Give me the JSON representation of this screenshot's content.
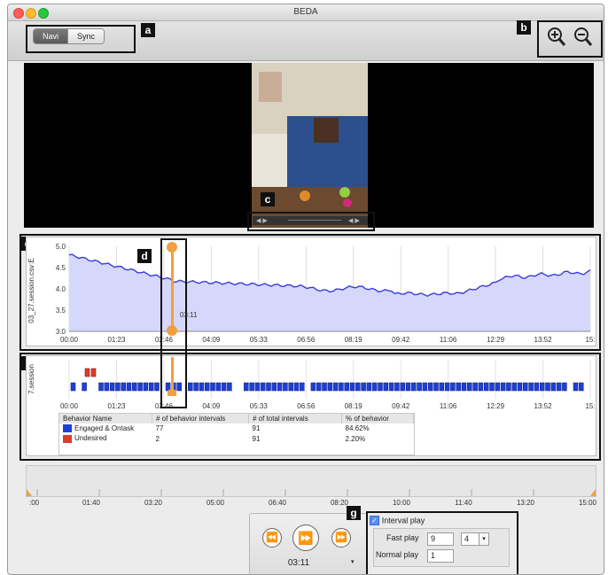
{
  "window": {
    "title": "BEDA"
  },
  "toolbar": {
    "segments": [
      {
        "label": "Navi",
        "selected": true
      },
      {
        "label": "Sync",
        "selected": false
      }
    ],
    "zoom_in_icon": "zoom-in-icon",
    "zoom_out_icon": "zoom-out-icon"
  },
  "callouts": {
    "a": "a",
    "b": "b",
    "c": "c",
    "d": "d",
    "e": "e",
    "f": "f",
    "g": "g"
  },
  "signal_chart": {
    "ylabel": "03_27.session.csv:E",
    "yticks": [
      "5.0",
      "4.5",
      "4.0",
      "3.5",
      "3.0"
    ],
    "xticks": [
      "00:00",
      "01:23",
      "02:46",
      "04:09",
      "05:33",
      "06:56",
      "08:19",
      "09:42",
      "11:06",
      "12:29",
      "13:52",
      "15:"
    ],
    "cursor_time": "03:11"
  },
  "behavior_chart": {
    "ylabel": "7.session",
    "xticks": [
      "00:00",
      "01:23",
      "02:46",
      "04:09",
      "05:33",
      "06:56",
      "08:19",
      "09:42",
      "11:06",
      "12:29",
      "13:52",
      "15:"
    ]
  },
  "behavior_table": {
    "headers": [
      "Behavior Name",
      "# of behavior intervals",
      "# of total intervals",
      "% of behavior"
    ],
    "rows": [
      {
        "name": "Engaged & Ontask",
        "color": "#1f3fd6",
        "intervals": "77",
        "total": "91",
        "percent": "84.62%"
      },
      {
        "name": "Undesired",
        "color": "#e03a2a",
        "intervals": "2",
        "total": "91",
        "percent": "2.20%"
      }
    ]
  },
  "timeline": {
    "ticks": [
      ":00",
      "01:40",
      "03:20",
      "05:00",
      "06:40",
      "08:20",
      "10:00",
      "11:40",
      "13:20",
      "15:00"
    ]
  },
  "playback": {
    "time": "03:11",
    "rewind_icon": "rewind-icon",
    "play_icon": "fast-play-icon",
    "forward_icon": "forward-icon"
  },
  "interval_play": {
    "label": "Interval play",
    "checked": true,
    "fast_play_label": "Fast play",
    "fast_play_value": "9",
    "fast_play_select": "4",
    "normal_play_label": "Normal play",
    "normal_play_value": "1"
  },
  "colors": {
    "signal_line": "#3a3adf",
    "signal_fill": "#d6d8fb",
    "cursor": "#f0a040",
    "engaged": "#1f3fd6",
    "undesired": "#e03a2a"
  }
}
